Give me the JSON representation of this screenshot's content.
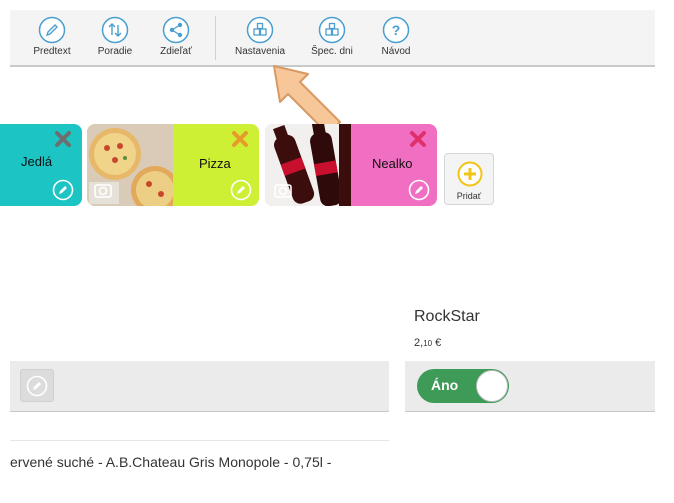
{
  "toolbar": {
    "items": [
      {
        "label": "Predtext",
        "icon": "pencil-icon"
      },
      {
        "label": "Poradie",
        "icon": "reorder-icon"
      },
      {
        "label": "Zdieľať",
        "icon": "share-icon"
      },
      {
        "label": "Nastavenia",
        "icon": "settings-boxes-icon"
      },
      {
        "label": "Špec. dni",
        "icon": "special-days-icon"
      },
      {
        "label": "Návod",
        "icon": "help-icon"
      }
    ],
    "icon_color": "#4a9fd0"
  },
  "categories": [
    {
      "label": "Jedlá",
      "color": "#1cc4c4",
      "delete_color": "#6e6e6e"
    },
    {
      "label": "Pizza",
      "color": "#cdf035",
      "delete_color": "#e89a2c"
    },
    {
      "label": "Nealko",
      "color": "#f16fc3",
      "delete_color": "#e0306b"
    }
  ],
  "add_button": {
    "label": "Pridať",
    "icon": "plus-circle-icon",
    "color": "#f2c418"
  },
  "product": {
    "name": "RockStar",
    "price_main": "2,",
    "price_cents": "10",
    "price_currency": " €",
    "toggle_label": "Áno",
    "toggle_color": "#3e9b57"
  },
  "description": "ervené suché - A.B.Chateau Gris Monopole - 0,75l -"
}
